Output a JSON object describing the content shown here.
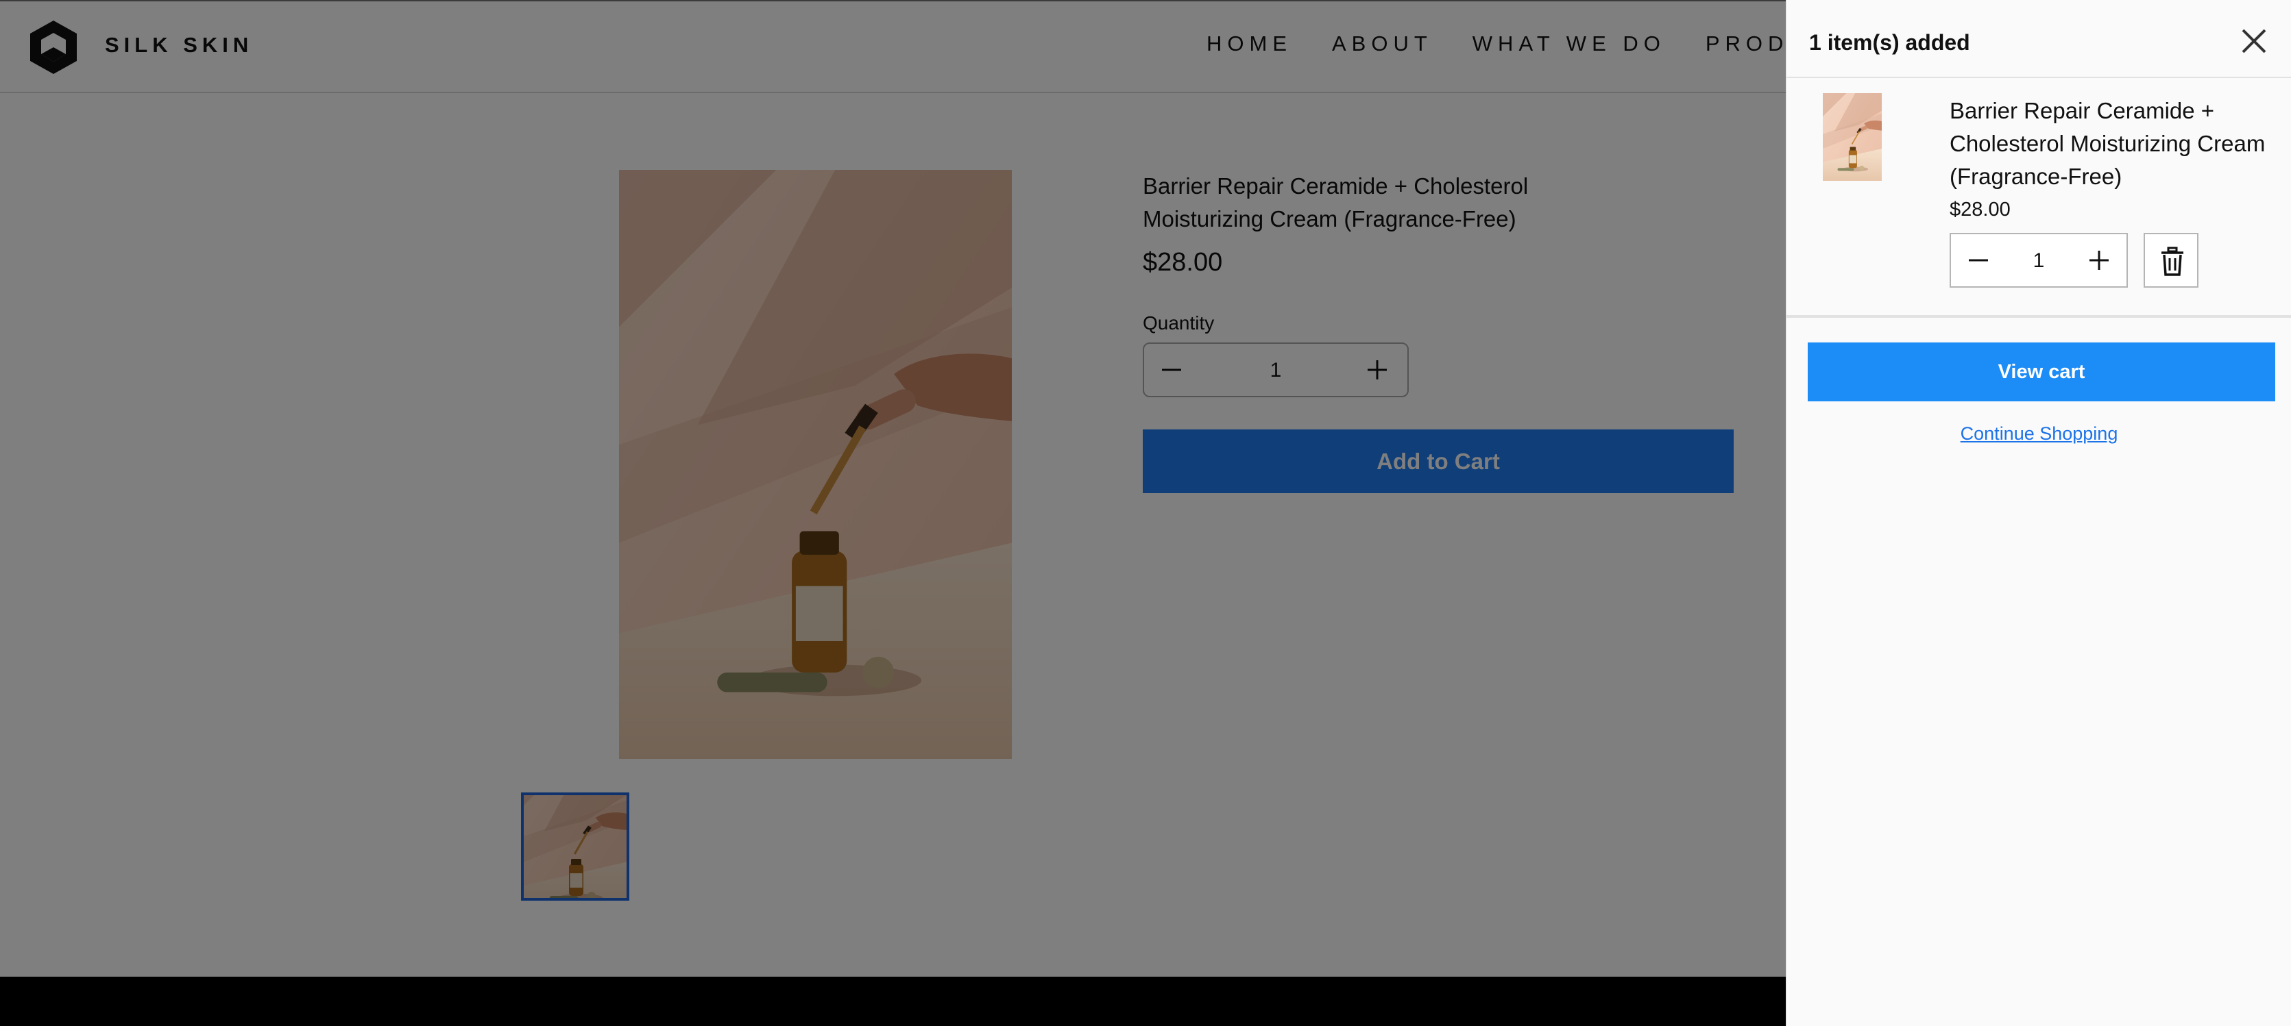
{
  "header": {
    "brand": "SILK SKIN",
    "nav": [
      "HOME",
      "ABOUT",
      "WHAT WE DO",
      "PRODUCT"
    ]
  },
  "product": {
    "title": "Barrier Repair Ceramide + Cholesterol Moisturizing Cream (Fragrance-Free)",
    "price": "$28.00",
    "quantity_label": "Quantity",
    "quantity": "1",
    "add_to_cart_label": "Add to Cart"
  },
  "cart_drawer": {
    "title": "1 item(s) added",
    "item": {
      "title": "Barrier Repair Ceramide + Cholesterol Moisturizing Cream (Fragrance-Free)",
      "price": "$28.00",
      "quantity": "1"
    },
    "view_cart_label": "View cart",
    "continue_label": "Continue Shopping"
  },
  "colors": {
    "primary_button": "#1c8cf7",
    "link": "#1c73e8",
    "thumb_border": "#1f62d8",
    "overlay": "rgba(0,0,0,0.5)"
  },
  "icons": [
    "logo-hexagon-icon",
    "close-icon",
    "minus-icon",
    "plus-icon",
    "trash-icon"
  ]
}
